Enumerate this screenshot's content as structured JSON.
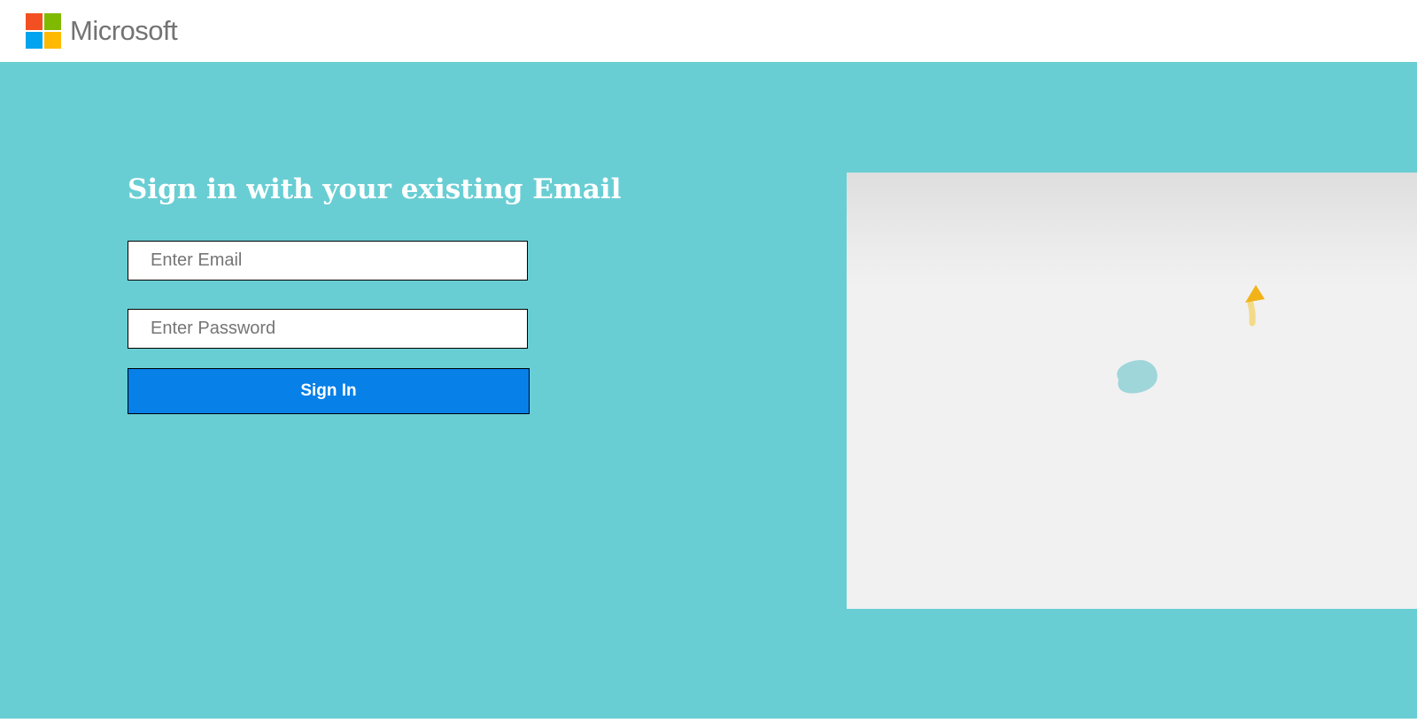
{
  "header": {
    "brand": "Microsoft",
    "logo_colors": [
      "#f25022",
      "#7fba00",
      "#00a4ef",
      "#ffb900"
    ]
  },
  "main": {
    "title": "Sign in with your existing Email",
    "email_placeholder": "Enter Email",
    "email_value": "",
    "password_placeholder": "Enter Password",
    "password_value": "",
    "signin_label": "Sign In"
  },
  "colors": {
    "background": "#69ced4",
    "button": "#0780e8",
    "preview_background": "#f1f1f1"
  },
  "preview": {
    "icons": [
      "arrow-pointer-icon",
      "blob-shape-icon"
    ]
  }
}
